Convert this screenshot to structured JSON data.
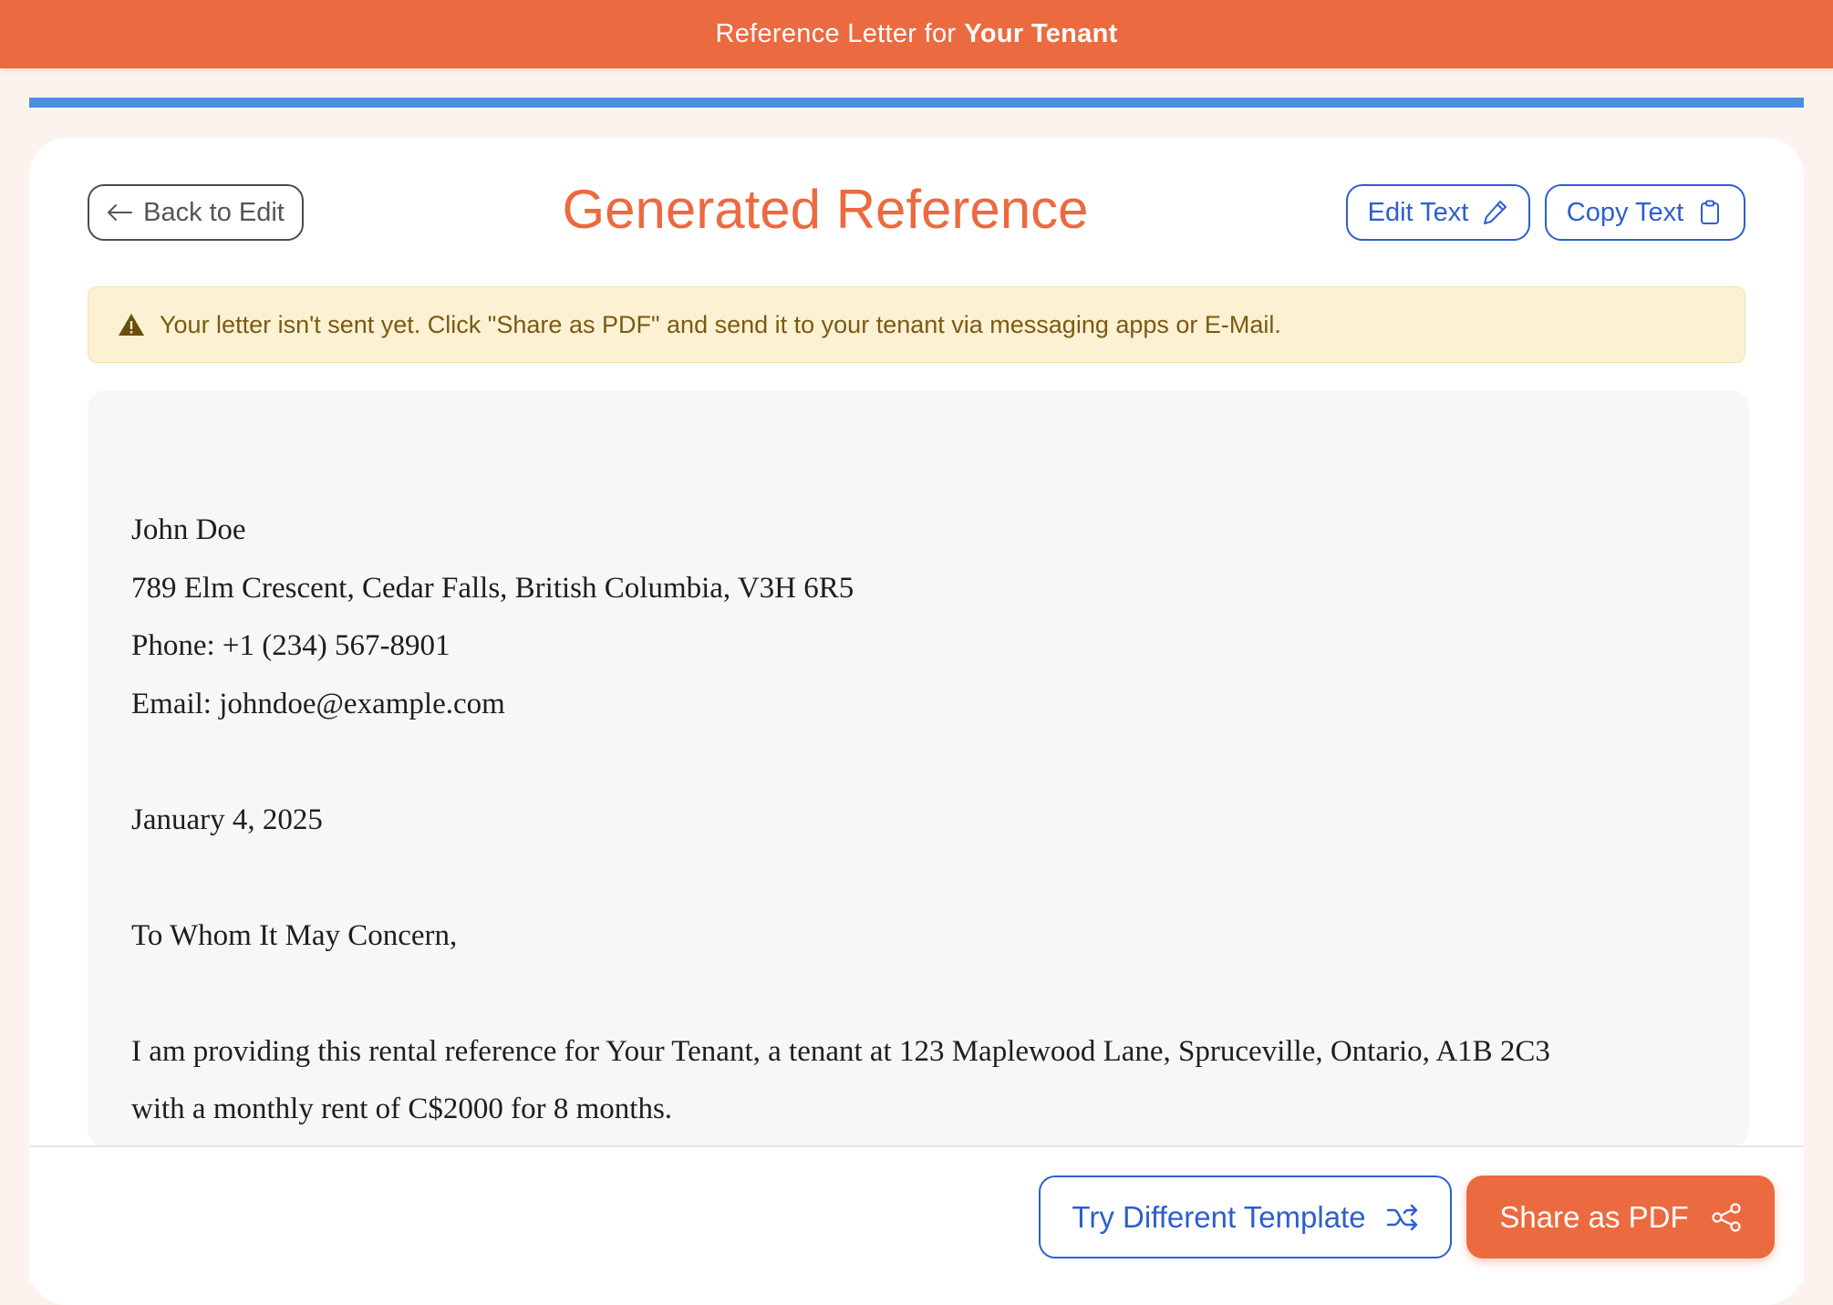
{
  "header": {
    "title_prefix": "Reference Letter for",
    "title_name": "Your Tenant"
  },
  "toolbar": {
    "back_label": "Back to Edit",
    "page_title": "Generated Reference",
    "edit_label": "Edit Text",
    "copy_label": "Copy Text"
  },
  "alert": {
    "message": "Your letter isn't sent yet. Click \"Share as PDF\" and send it to your tenant via messaging apps or E-Mail."
  },
  "letter": {
    "sender_name": "John Doe",
    "sender_address": "789 Elm Crescent, Cedar Falls, British Columbia, V3H 6R5",
    "sender_phone": "Phone: +1 (234) 567-8901",
    "sender_email": "Email: johndoe@example.com",
    "date": "January 4, 2025",
    "salutation": "To Whom It May Concern,",
    "body_line_1": "I am providing this rental reference for Your Tenant, a tenant at 123 Maplewood Lane, Spruceville, Ontario, A1B 2C3",
    "body_line_2": "with a monthly rent of C$2000 for 8 months."
  },
  "footer": {
    "template_label": "Try Different Template",
    "share_label": "Share as PDF"
  },
  "icons": {
    "back": "arrow-left-icon",
    "edit": "pencil-icon",
    "copy": "clipboard-icon",
    "alert": "warning-icon",
    "template": "shuffle-icon",
    "share": "share-icon"
  },
  "colors": {
    "brand": "#ec6a3f",
    "accent_blue": "#2c5fcf",
    "progress_blue": "#4a90e2",
    "alert_bg": "#fcf1d3",
    "alert_text": "#7a5a12"
  }
}
